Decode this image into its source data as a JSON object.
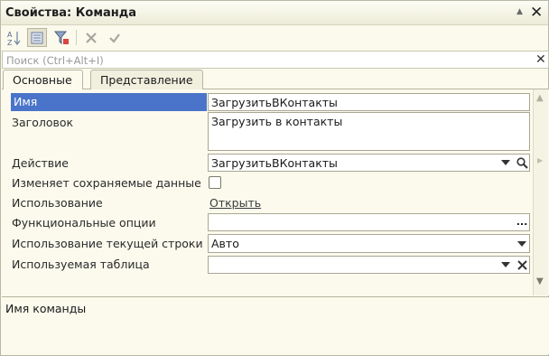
{
  "window": {
    "title": "Свойства: Команда"
  },
  "toolbar": {
    "icons": [
      "sort-az-icon",
      "categories-icon",
      "filter-icon",
      "cancel-icon",
      "apply-icon"
    ]
  },
  "search": {
    "placeholder": "Поиск (Ctrl+Alt+I)"
  },
  "tabs": [
    {
      "label": "Основные",
      "active": true
    },
    {
      "label": "Представление",
      "active": false
    }
  ],
  "properties": {
    "name": {
      "label": "Имя",
      "value": "ЗагрузитьВКонтакты"
    },
    "title": {
      "label": "Заголовок",
      "value": "Загрузить в контакты"
    },
    "action": {
      "label": "Действие",
      "value": "ЗагрузитьВКонтакты"
    },
    "modifies_data": {
      "label": "Изменяет сохраняемые данные",
      "checked": false
    },
    "usage": {
      "label": "Использование",
      "link": "Открыть"
    },
    "functional_options": {
      "label": "Функциональные опции",
      "value": ""
    },
    "current_row_usage": {
      "label": "Использование текущей строки",
      "value": "Авто"
    },
    "used_table": {
      "label": "Используемая таблица",
      "value": ""
    }
  },
  "description": {
    "text": "Имя команды"
  },
  "colors": {
    "accent": "#4a74c9",
    "background": "#fbfaed"
  }
}
